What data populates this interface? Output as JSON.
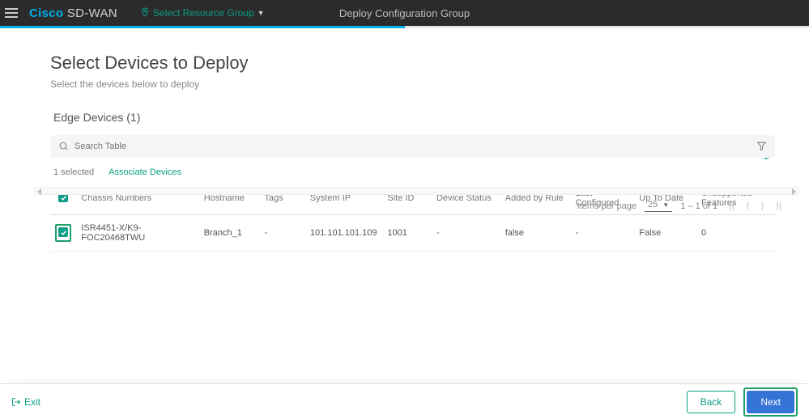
{
  "header": {
    "brand_main": "Cisco",
    "brand_sub": "SD-WAN",
    "resource_group_label": "Select Resource Group",
    "center_title": "Deploy Configuration Group"
  },
  "page": {
    "title": "Select Devices to Deploy",
    "subtitle": "Select the devices below to deploy",
    "section_title": "Edge Devices (1)"
  },
  "search": {
    "placeholder": "Search Table"
  },
  "meta": {
    "selected_text": "1 selected",
    "associate_label": "Associate Devices"
  },
  "table": {
    "headers": [
      "Chassis Numbers",
      "Hostname",
      "Tags",
      "System IP",
      "Site ID",
      "Device Status",
      "Added by Rule",
      "Last Configured",
      "Up To Date",
      "Unsupported Features"
    ],
    "rows": [
      {
        "chassis": "ISR4451-X/K9-FOC20468TWU",
        "hostname": "Branch_1",
        "tags": "-",
        "system_ip": "101.101.101.109",
        "site_id": "1001",
        "device_status": "-",
        "added_by_rule": "false",
        "last_configured": "-",
        "up_to_date": "False",
        "unsupported": "0",
        "selected": true
      }
    ]
  },
  "pager": {
    "items_label": "Items per page",
    "per_page": "25",
    "range": "1 – 1 of 1"
  },
  "footer": {
    "exit": "Exit",
    "back": "Back",
    "next": "Next"
  }
}
